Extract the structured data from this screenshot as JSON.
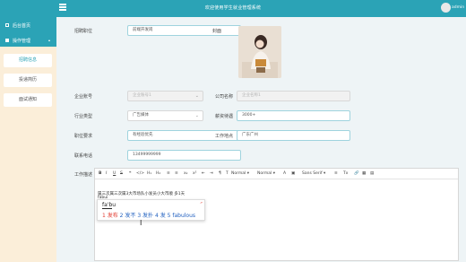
{
  "header": {
    "title": "欢迎使用学生就业管理系统",
    "user": "admin"
  },
  "sidebar": {
    "home": "后台首页",
    "group": "操作管理",
    "items": [
      {
        "label": "招聘信息"
      },
      {
        "label": "投递简历"
      },
      {
        "label": "面试通知"
      }
    ]
  },
  "form": {
    "job_title": {
      "label": "招聘职位",
      "value": "前端开发岗"
    },
    "cover": {
      "label": "封面"
    },
    "company_account": {
      "label": "企业账号",
      "value": "企业账号1"
    },
    "company_name": {
      "label": "公司名称",
      "value": "企业名称1"
    },
    "industry": {
      "label": "行业类型",
      "value": "广告媒体"
    },
    "salary": {
      "label": "薪资待遇",
      "value": "3000+"
    },
    "requirement": {
      "label": "职位要求",
      "value": "有经验优先"
    },
    "location": {
      "label": "工作地点",
      "value": "广东广州"
    },
    "phone": {
      "label": "联系电话",
      "value": "13499999999"
    },
    "description": {
      "label": "工作描述"
    }
  },
  "editor": {
    "toolbar": [
      "B",
      "I",
      "U",
      "S",
      "❝",
      "</>",
      "H₁",
      "H₂",
      "≡",
      "≡",
      "x₂",
      "x²",
      "⇤",
      "⇥",
      "¶",
      "T",
      "Normal ▾",
      "Normal ▾",
      "A",
      "▣",
      "Sans Serif ▾",
      "≡",
      "Tx",
      "🔗",
      "▦",
      "▤"
    ],
    "content": "属三次属三次属3大市场队小发员小大市顺 多1天",
    "content_line2": "fabui"
  },
  "ime": {
    "composition": "fa'bu",
    "candidates": [
      "1 发布",
      "2 发不",
      "3 发扑",
      "4 发",
      "5 fabulous"
    ],
    "tag": "ABC"
  }
}
